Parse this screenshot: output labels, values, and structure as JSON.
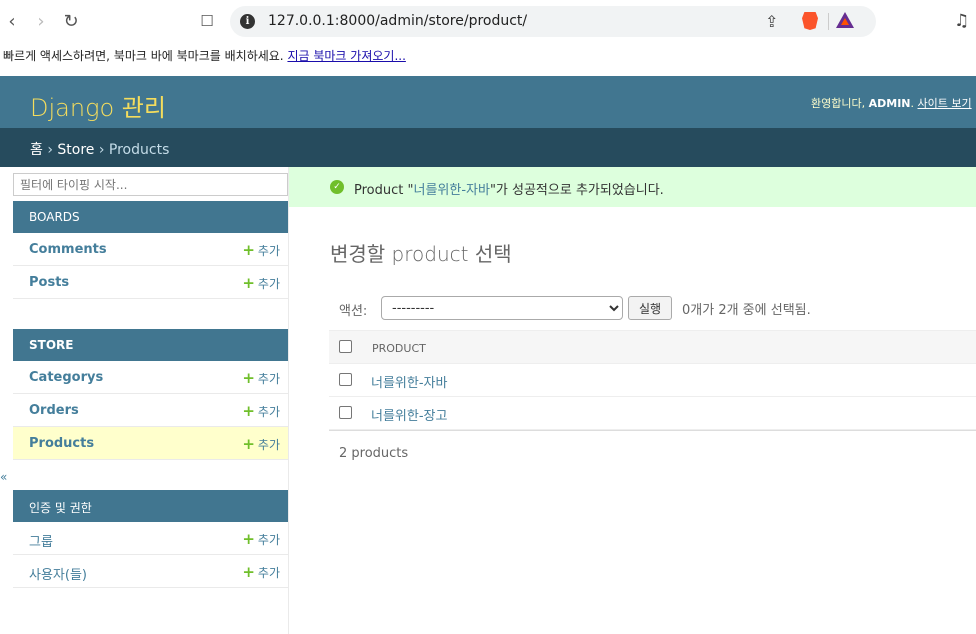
{
  "browser": {
    "url": "127.0.0.1:8000/admin/store/product/",
    "bookmarks_hint": "빠르게 액세스하려면, 북마크 바에 북마크를 배치하세요.",
    "bookmarks_link": "지금 북마크 가져오기..."
  },
  "header": {
    "branding": "Django 관리",
    "welcome": "환영합니다,",
    "username": "ADMIN",
    "site_link": "사이트 보기"
  },
  "breadcrumbs": {
    "home": "홈",
    "sep": " › ",
    "app": "Store",
    "current": "Products"
  },
  "sidebar": {
    "filter_placeholder": "필터에 타이핑 시작...",
    "add_label": "추가",
    "collapse_glyph": "«",
    "modules": [
      {
        "caption": "BOARDS",
        "rows": [
          {
            "name": "Comments"
          },
          {
            "name": "Posts"
          }
        ]
      },
      {
        "caption": "STORE",
        "rows": [
          {
            "name": "Categorys"
          },
          {
            "name": "Orders"
          },
          {
            "name": "Products"
          }
        ]
      },
      {
        "caption": "인증 및 권한",
        "rows": [
          {
            "name": "그룹"
          },
          {
            "name": "사용자(들)"
          }
        ]
      }
    ]
  },
  "message": {
    "prefix": "Product \"",
    "link": "너를위한-자바",
    "suffix": "\"가 성공적으로 추가되었습니다."
  },
  "content": {
    "title": "변경할 product 선택",
    "action_label": "액션:",
    "action_selected": "---------",
    "go_button": "실행",
    "counter": "0개가 2개 중에 선택됨.",
    "column_header": "PRODUCT",
    "rows": [
      "너를위한-자바",
      "너를위한-장고"
    ],
    "paginator": "2 products"
  },
  "colors": {
    "header_bg": "#417690",
    "breadcrumb_bg": "#264b5d",
    "branding": "#f5dd5d",
    "success_bg": "#ddffdd",
    "current_row": "#ffffcc",
    "add_plus": "#70bf2b"
  }
}
